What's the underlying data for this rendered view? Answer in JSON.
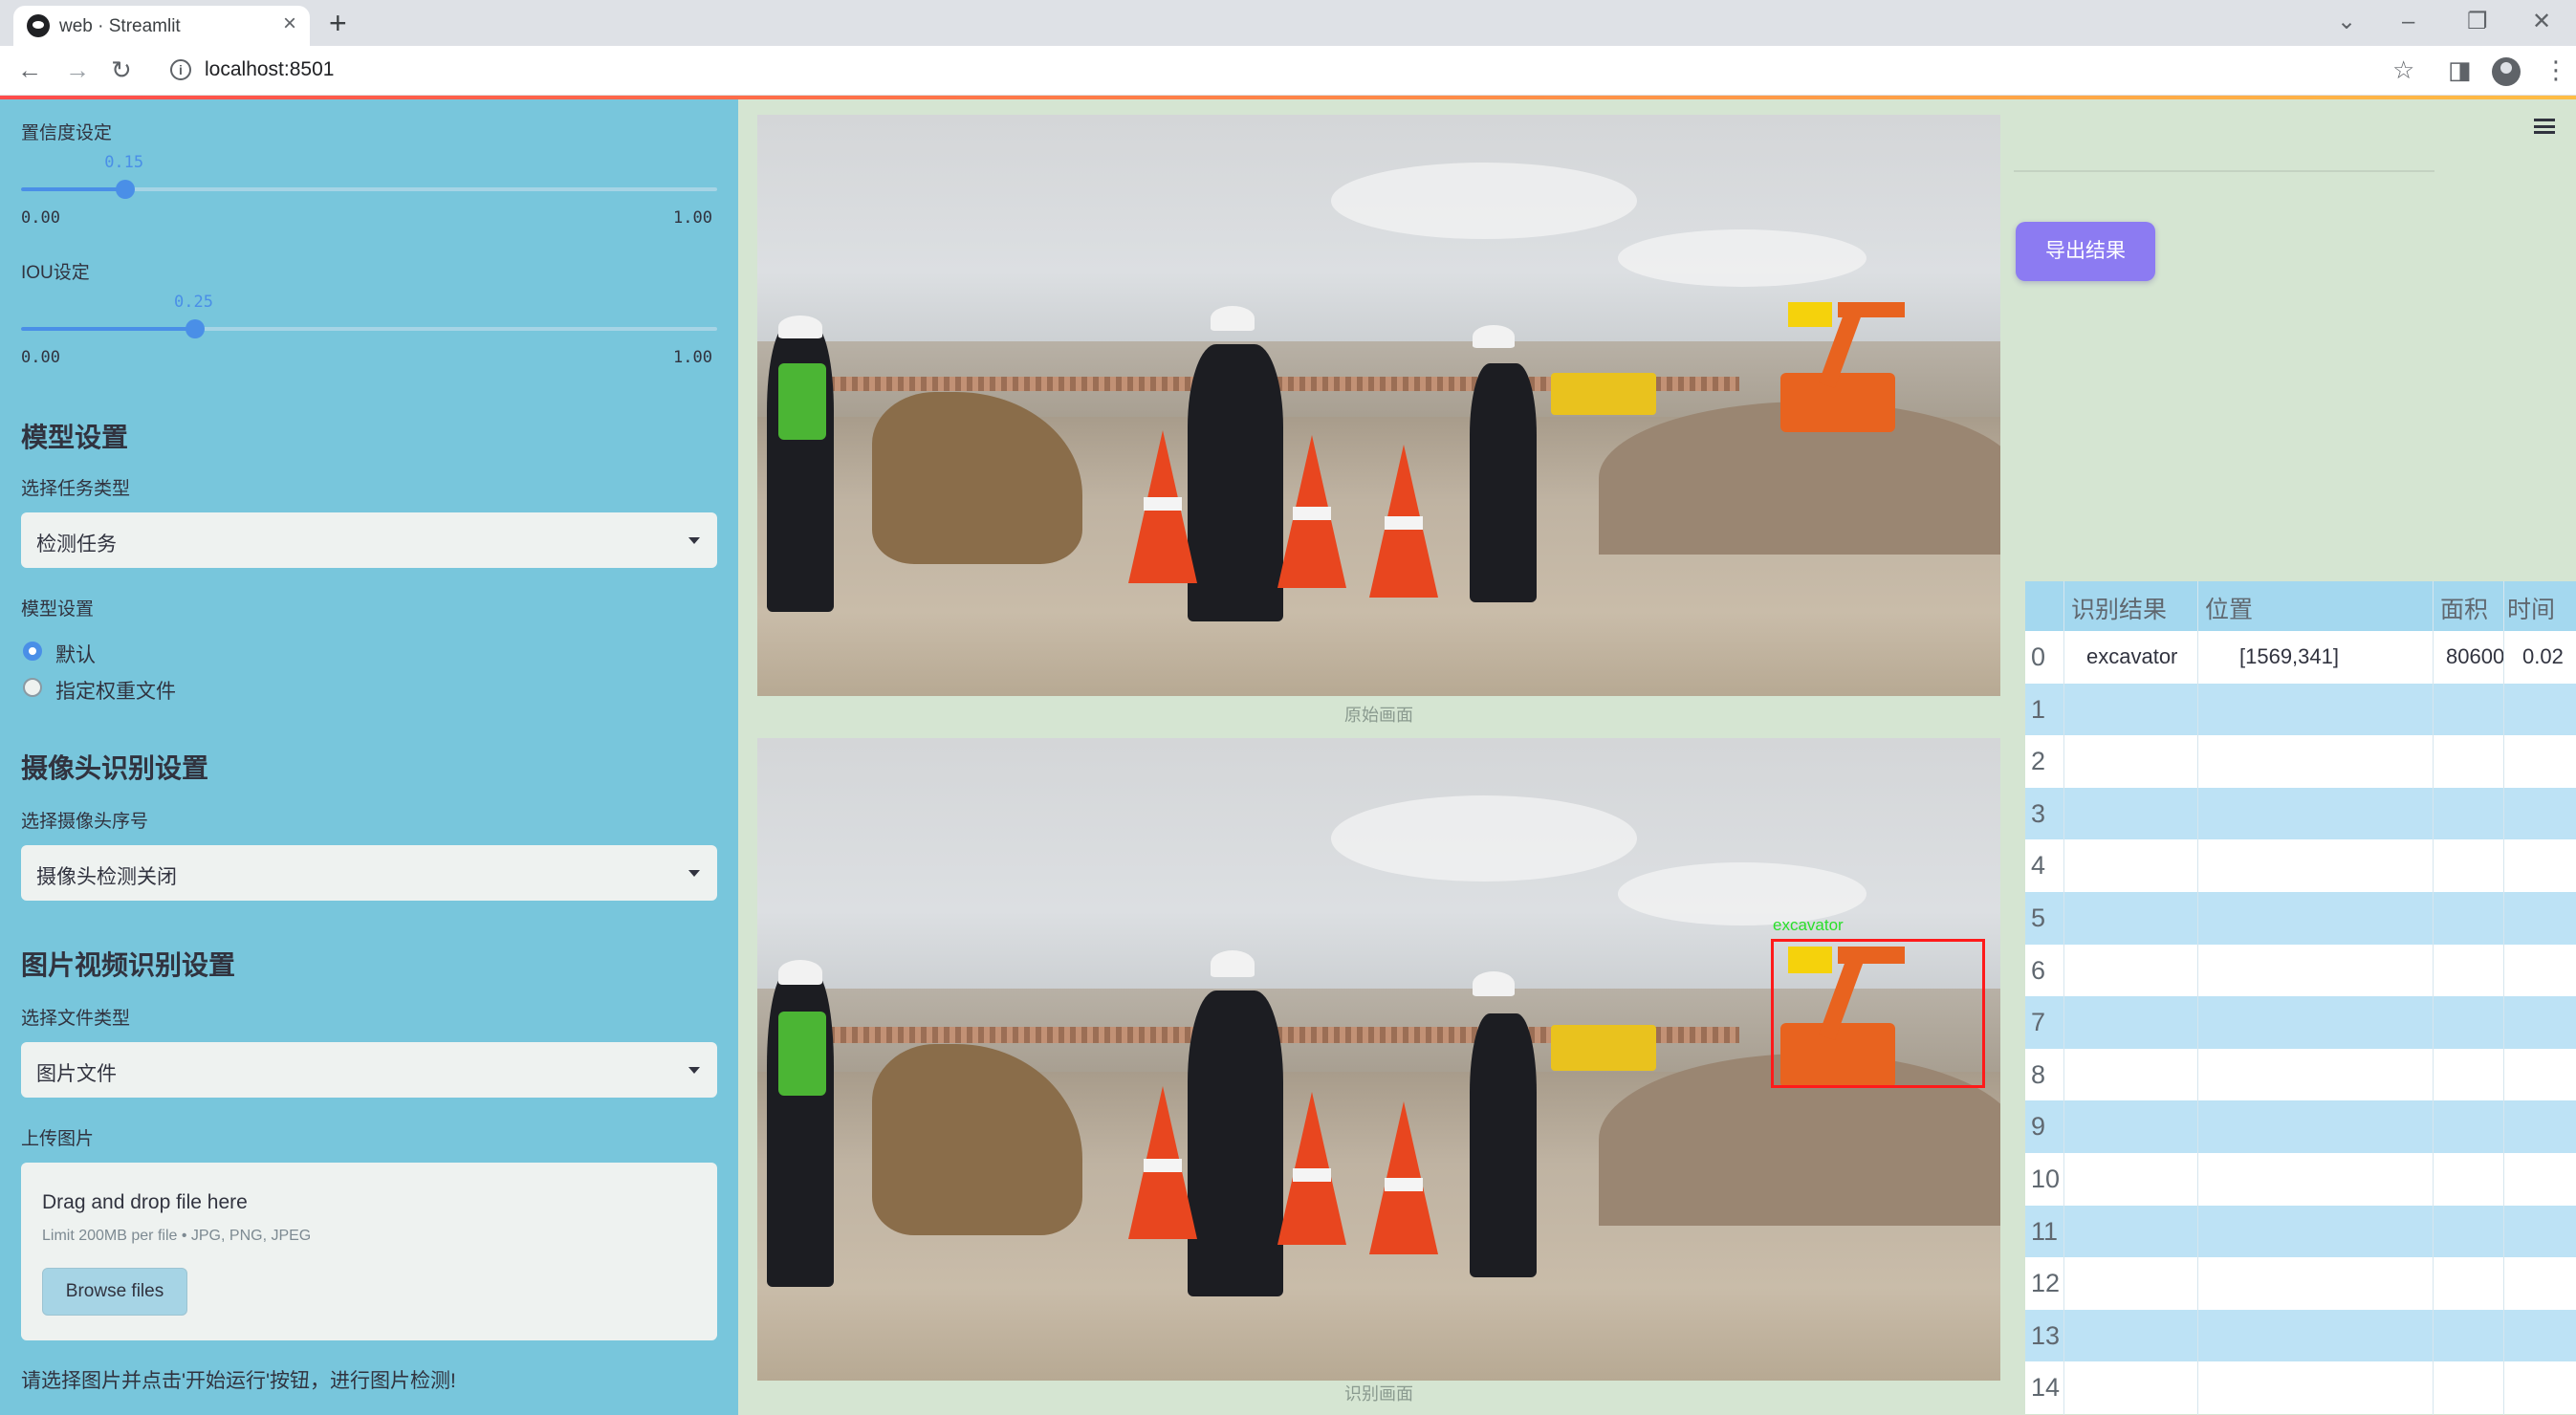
{
  "browser": {
    "tab_title": "web · Streamlit",
    "url": "localhost:8501"
  },
  "sidebar": {
    "confidence": {
      "label": "置信度设定",
      "value": "0.15",
      "min": "0.00",
      "max": "1.00",
      "fraction": 0.15
    },
    "iou": {
      "label": "IOU设定",
      "value": "0.25",
      "min": "0.00",
      "max": "1.00",
      "fraction": 0.25
    },
    "model_section": {
      "heading": "模型设置",
      "task_label": "选择任务类型",
      "task_value": "检测任务",
      "model_label": "模型设置",
      "options": [
        "默认",
        "指定权重文件"
      ],
      "selected_index": 0
    },
    "camera_section": {
      "heading": "摄像头识别设置",
      "label": "选择摄像头序号",
      "value": "摄像头检测关闭"
    },
    "media_section": {
      "heading": "图片视频识别设置",
      "type_label": "选择文件类型",
      "type_value": "图片文件",
      "upload_label": "上传图片",
      "drop_text": "Drag and drop file here",
      "limit_text": "Limit 200MB per file • JPG, PNG, JPEG",
      "browse_label": "Browse files"
    },
    "hint": "请选择图片并点击'开始运行'按钮，进行图片检测!"
  },
  "main": {
    "original_caption": "原始画面",
    "result_caption": "识别画面",
    "detection_label": "excavator",
    "export_label": "导出结果",
    "table": {
      "headers": [
        "识别结果",
        "位置",
        "面积",
        "时间"
      ],
      "rows": [
        {
          "index": "0",
          "result": "excavator",
          "position": "[1569,341]",
          "area": "80600",
          "time": "0.02"
        },
        {
          "index": "1"
        },
        {
          "index": "2"
        },
        {
          "index": "3"
        },
        {
          "index": "4"
        },
        {
          "index": "5"
        },
        {
          "index": "6"
        },
        {
          "index": "7"
        },
        {
          "index": "8"
        },
        {
          "index": "9"
        },
        {
          "index": "10"
        },
        {
          "index": "11"
        },
        {
          "index": "12"
        },
        {
          "index": "13"
        },
        {
          "index": "14"
        }
      ]
    }
  },
  "colors": {
    "sidebar_bg": "#78c6dc",
    "main_bg": "#d5e5d2",
    "slider_accent": "#4a8fe7",
    "export_button": "#8c7bf2",
    "detection_box": "#ff1a1a",
    "detection_label": "#2adf2a"
  },
  "icons": [
    "streamlit-favicon",
    "close-icon",
    "plus-icon",
    "back-arrow-icon",
    "forward-arrow-icon",
    "reload-icon",
    "info-icon",
    "star-icon",
    "sidebar-icon",
    "avatar-icon",
    "kebab-menu-icon",
    "hamburger-menu-icon",
    "chevron-down-icon"
  ]
}
